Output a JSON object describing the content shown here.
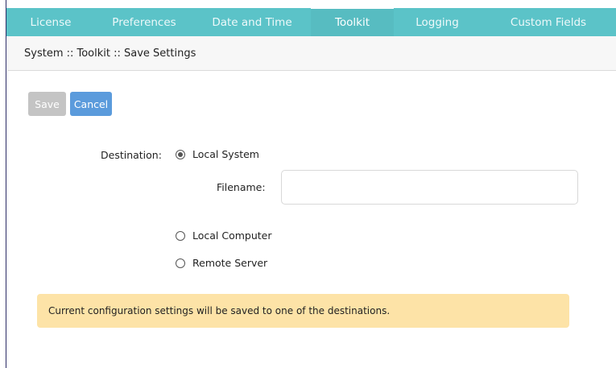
{
  "tabs": [
    {
      "label": "License",
      "active": false
    },
    {
      "label": "Preferences",
      "active": false
    },
    {
      "label": "Date and Time",
      "active": false
    },
    {
      "label": "Toolkit",
      "active": true
    },
    {
      "label": "Logging",
      "active": false
    },
    {
      "label": "Custom Fields",
      "active": false
    }
  ],
  "breadcrumb": "System :: Toolkit :: Save Settings",
  "buttons": {
    "save": "Save",
    "cancel": "Cancel"
  },
  "form": {
    "destination_label": "Destination:",
    "options": [
      {
        "label": "Local System",
        "selected": true
      },
      {
        "label": "Local Computer",
        "selected": false
      },
      {
        "label": "Remote Server",
        "selected": false
      }
    ],
    "filename_label": "Filename:",
    "filename_value": ""
  },
  "alert": "Current configuration settings will be saved to one of the destinations.",
  "colors": {
    "tab_bar": "#5bc3c8",
    "save_disabled": "#c4c4c4",
    "cancel": "#5b9bdc",
    "alert_bg": "#fde3a7"
  }
}
